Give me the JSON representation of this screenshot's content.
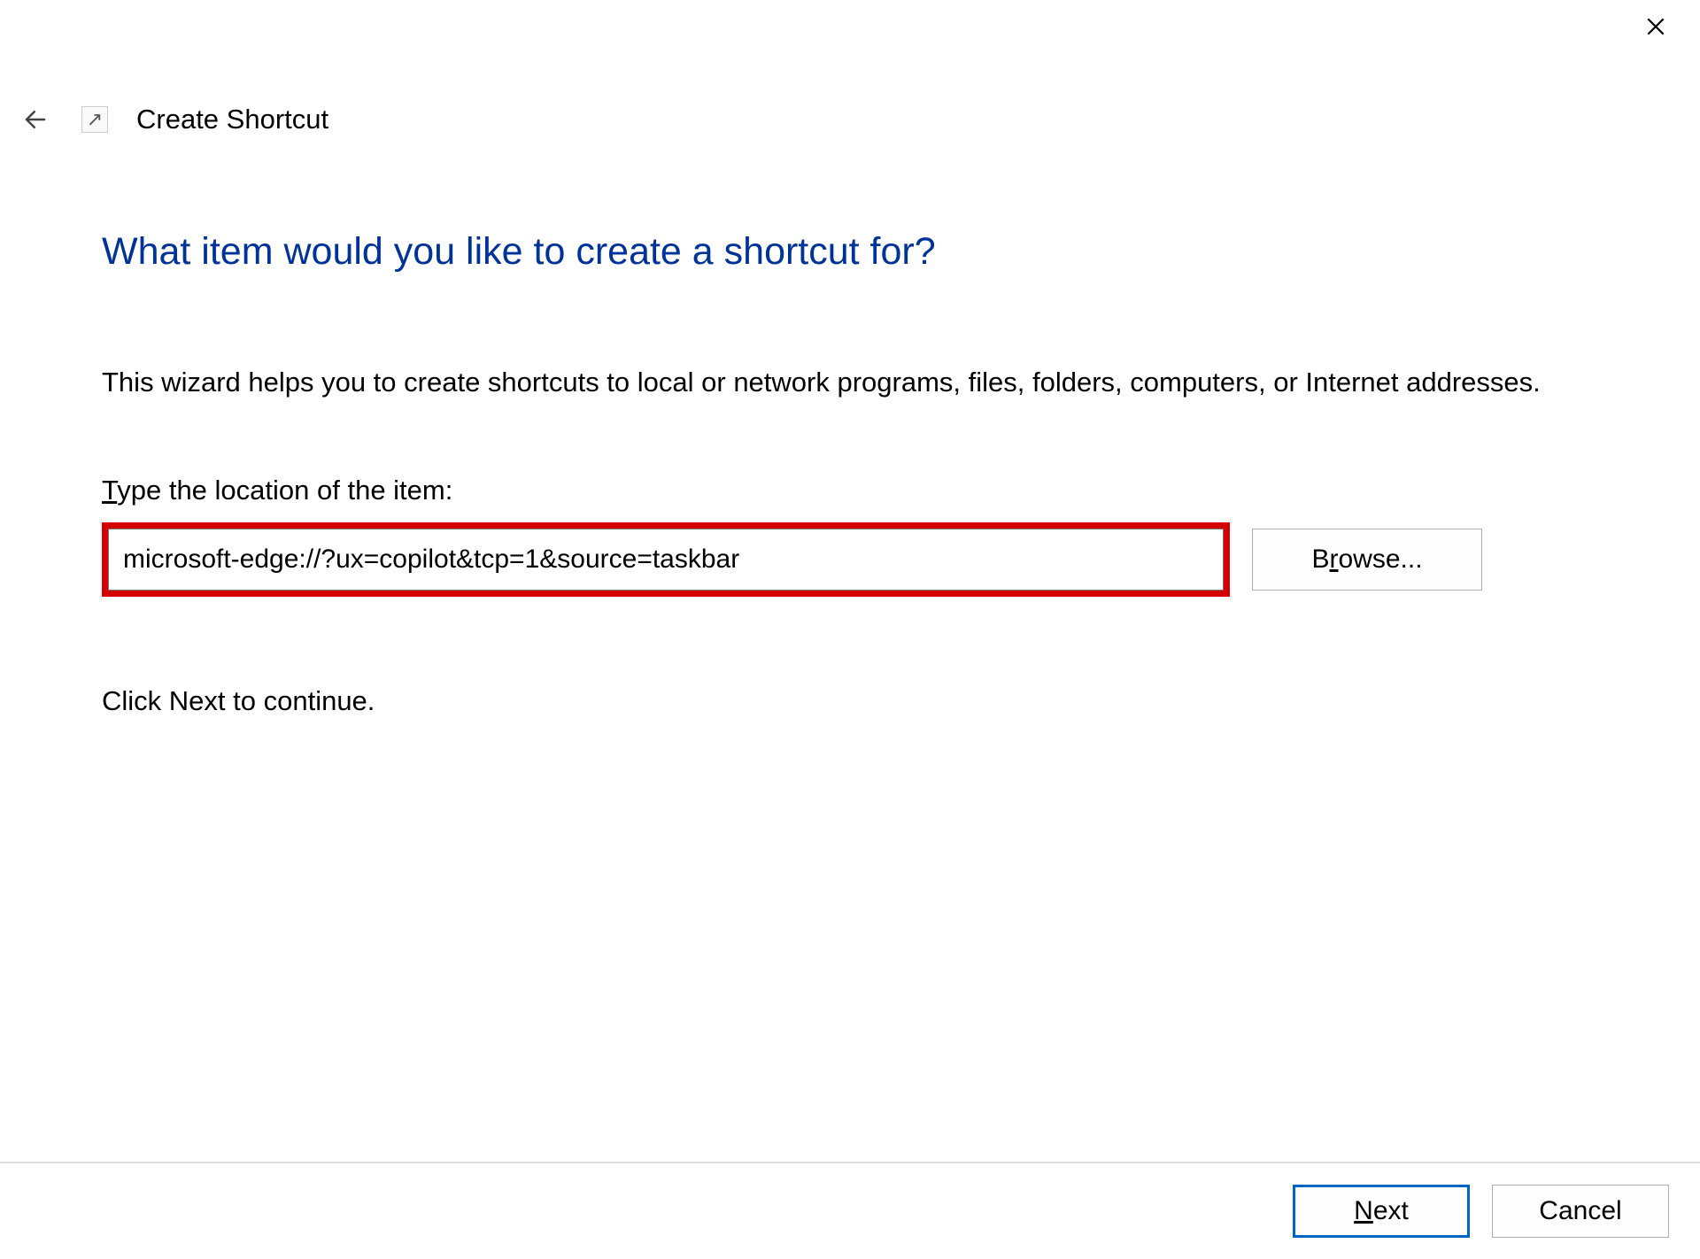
{
  "window": {
    "title": "Create Shortcut"
  },
  "heading": "What item would you like to create a shortcut for?",
  "description": "This wizard helps you to create shortcuts to local or network programs, files, folders, computers, or Internet addresses.",
  "input": {
    "label_prefix": "T",
    "label_rest": "ype the location of the item:",
    "value": "microsoft-edge://?ux=copilot&tcp=1&source=taskbar"
  },
  "browse": {
    "prefix": "B",
    "underline": "r",
    "suffix": "owse..."
  },
  "continue_text": "Click Next to continue.",
  "footer": {
    "next_underline": "N",
    "next_rest": "ext",
    "cancel": "Cancel"
  }
}
